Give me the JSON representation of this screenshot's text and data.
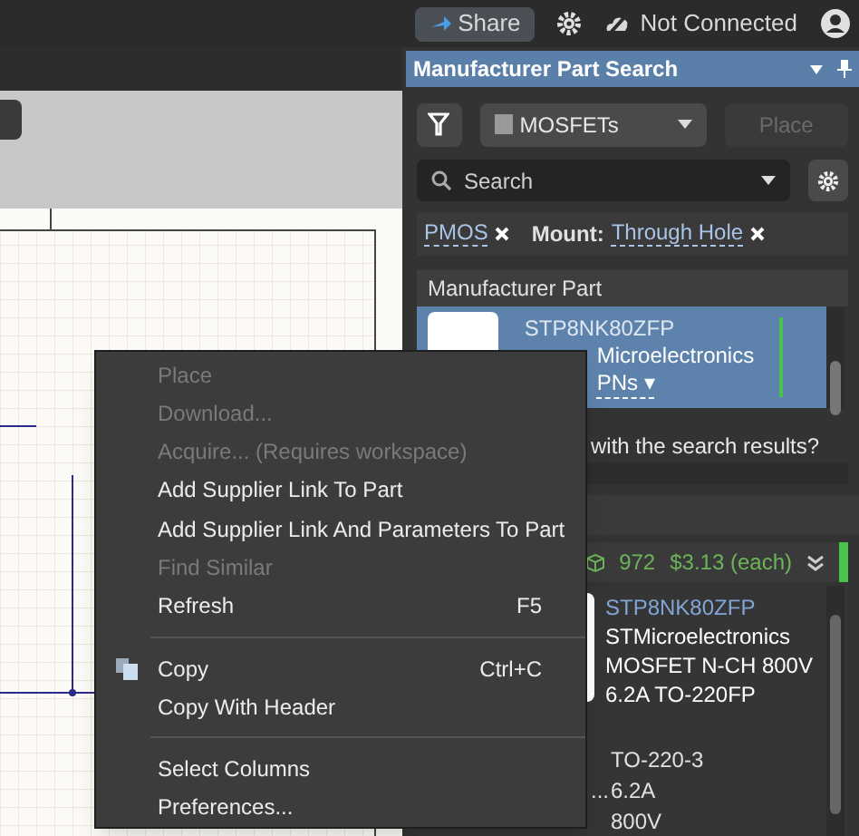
{
  "top_bar": {
    "share": "Share",
    "connection": "Not Connected"
  },
  "panel": {
    "title": "Manufacturer Part Search",
    "category": "MOSFETs",
    "place": {
      "label": "Place",
      "disabled": true
    },
    "search": {
      "placeholder": "Search"
    },
    "filters": [
      {
        "label": "PMOS"
      },
      {
        "name": "Mount:",
        "label": "Through Hole"
      }
    ],
    "table": {
      "columns": [
        "Manufacturer Part"
      ],
      "rows": [
        {
          "selected": true,
          "part": "STP8NK80ZFP",
          "maker": "Microelectronics",
          "link": "PNs ▾"
        }
      ]
    },
    "feedback": "with the search results?",
    "detail": {
      "stock": "972",
      "price": "$3.13 (each)",
      "part": "STP8NK80ZFP",
      "description": [
        "STMicroelectronics",
        "MOSFET N-CH 800V",
        "6.2A TO-220FP"
      ],
      "params": [
        {
          "value": "TO-220-3"
        },
        {
          "label": "...",
          "value": "6.2A"
        },
        {
          "value": "800V"
        }
      ]
    }
  },
  "context_menu": [
    {
      "kind": "item",
      "label": "Place",
      "disabled": true
    },
    {
      "kind": "item",
      "label": "Download...",
      "disabled": true
    },
    {
      "kind": "item",
      "label": "Acquire... (Requires workspace)",
      "disabled": true
    },
    {
      "kind": "item",
      "label": "Add Supplier Link To Part",
      "disabled": false
    },
    {
      "kind": "item",
      "label": "Add Supplier Link And Parameters To Part",
      "disabled": false
    },
    {
      "kind": "item",
      "label": "Find Similar",
      "disabled": true
    },
    {
      "kind": "item",
      "label": "Refresh",
      "shortcut": "F5",
      "disabled": false
    },
    {
      "kind": "separator"
    },
    {
      "kind": "item",
      "label": "Copy",
      "shortcut": "Ctrl+C",
      "icon": true,
      "disabled": false
    },
    {
      "kind": "item",
      "label": "Copy With Header",
      "disabled": false
    },
    {
      "kind": "separator"
    },
    {
      "kind": "item",
      "label": "Select Columns",
      "disabled": false
    },
    {
      "kind": "item",
      "label": "Preferences...",
      "disabled": false
    }
  ]
}
